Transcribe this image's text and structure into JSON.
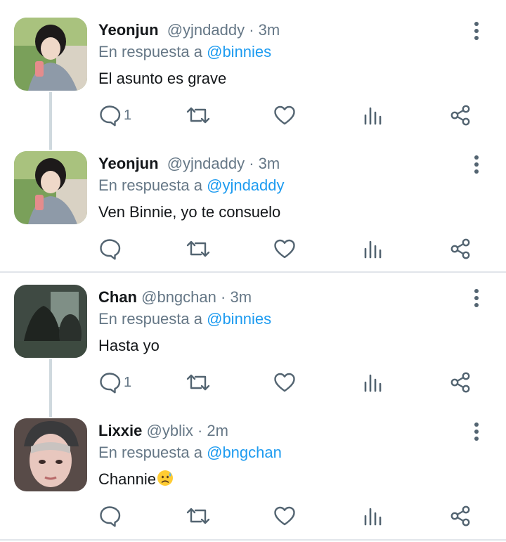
{
  "reply_prefix": "En respuesta a",
  "tweets": [
    {
      "name": "Yeonjun",
      "handle": "@yjndaddy",
      "dot": "·",
      "time": "3m",
      "reply_to": "@binnies",
      "text": "El asunto es grave",
      "reply_count": "1",
      "avatar": "avatar-yeonjun"
    },
    {
      "name": "Yeonjun",
      "handle": "@yjndaddy",
      "dot": "·",
      "time": "3m",
      "reply_to": "@yjndaddy",
      "text": "Ven Binnie, yo te consuelo",
      "reply_count": "",
      "avatar": "avatar-yeonjun"
    },
    {
      "name": "Chan",
      "handle": "@bngchan",
      "dot": "·",
      "time": "3m",
      "reply_to": "@binnies",
      "text": "Hasta yo",
      "reply_count": "1",
      "avatar": "avatar-chan"
    },
    {
      "name": "Lixxie",
      "handle": "@yblix",
      "dot": "·",
      "time": "2m",
      "reply_to": "@bngchan",
      "text": "Channie",
      "emoji": "sad-sweat-face-emoji",
      "reply_count": "",
      "avatar": "avatar-lixxie"
    }
  ],
  "icons": {
    "reply": "reply-icon",
    "retweet": "retweet-icon",
    "like": "like-icon",
    "views": "views-icon",
    "share": "share-icon",
    "more": "more-options-icon"
  },
  "colors": {
    "mention": "#1d9bf0",
    "secondary_text": "#657786",
    "icon": "#536471",
    "divider": "#e1e5ea"
  }
}
